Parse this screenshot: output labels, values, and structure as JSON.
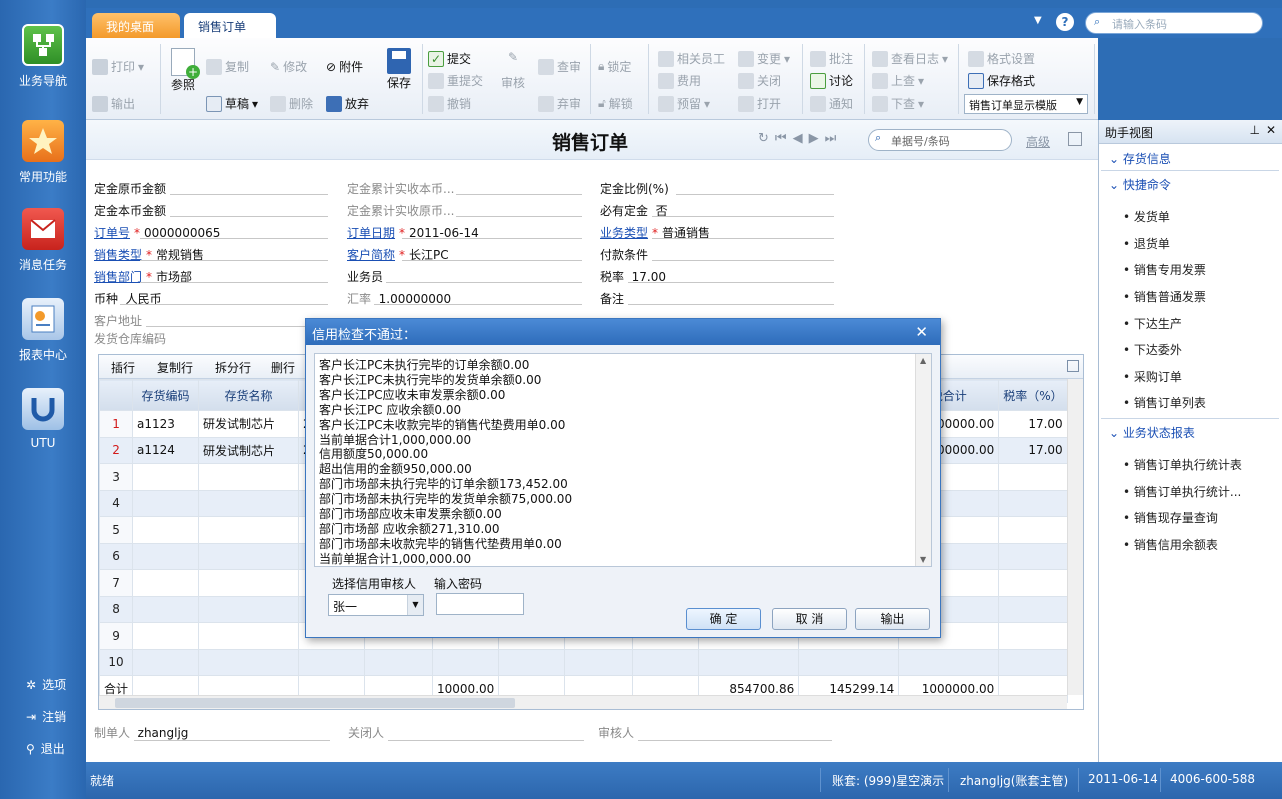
{
  "nav": {
    "items": [
      {
        "label": "业务导航",
        "icon": "flowchart-icon"
      },
      {
        "label": "常用功能",
        "icon": "star-icon"
      },
      {
        "label": "消息任务",
        "icon": "envelope-icon"
      },
      {
        "label": "报表中心",
        "icon": "report-icon"
      },
      {
        "label": "UTU",
        "icon": "utu-icon"
      }
    ],
    "bottom": [
      {
        "label": "选项",
        "icon": "gear-icon"
      },
      {
        "label": "注销",
        "icon": "logout-icon"
      },
      {
        "label": "退出",
        "icon": "key-icon"
      }
    ]
  },
  "tabs": [
    {
      "label": "我的桌面"
    },
    {
      "label": "销售订单"
    }
  ],
  "search": {
    "placeholder": "请输入条码"
  },
  "toolbar": {
    "print": "打印",
    "export": "输出",
    "ref": "参照",
    "copy": "复制",
    "draft": "草稿",
    "modify": "修改",
    "delete": "删除",
    "attach": "附件",
    "abandon": "放弃",
    "save": "保存",
    "submit": "提交",
    "resubmit": "重提交",
    "revoke": "撤销",
    "audit": "审核",
    "check_audit": "查审",
    "abandon_audit": "弃审",
    "lock": "锁定",
    "unlock": "解锁",
    "staff": "相关员工",
    "fee": "费用",
    "reserve": "预留",
    "change": "变更",
    "close": "关闭",
    "open": "打开",
    "annotate": "批注",
    "discuss": "讨论",
    "notify": "通知",
    "view_log": "查看日志",
    "prev": "上查",
    "next": "下查",
    "format_settings": "格式设置",
    "save_format": "保存格式",
    "template": "销售订单显示模版"
  },
  "form": {
    "title": "销售订单",
    "doc_search_placeholder": "单据号/条码",
    "advanced": "高级",
    "fields": {
      "deposit_orig_label": "定金原币金额",
      "deposit_local_label": "定金本币金额",
      "deposit_recv_local_label": "定金累计实收本币...",
      "deposit_recv_orig_label": "定金累计实收原币...",
      "deposit_ratio_label": "定金比例(%)",
      "must_deposit_label": "必有定金",
      "must_deposit": "否",
      "order_no_label": "订单号",
      "order_no": "0000000065",
      "order_date_label": "订单日期",
      "order_date": "2011-06-14",
      "biz_type_label": "业务类型",
      "biz_type": "普通销售",
      "sales_type_label": "销售类型",
      "sales_type": "常规销售",
      "customer_label": "客户简称",
      "customer": "长江PC",
      "payment_label": "付款条件",
      "dept_label": "销售部门",
      "dept": "市场部",
      "salesman_label": "业务员",
      "tax_rate_label": "税率",
      "tax_rate": "17.00",
      "currency_label": "币种",
      "currency": "人民币",
      "rate_label": "汇率",
      "rate": "1.00000000",
      "remark_label": "备注",
      "cust_addr_label": "客户地址",
      "ship_wh_label": "发货仓库编码"
    },
    "grid_toolbar": [
      "插行",
      "复制行",
      "拆分行",
      "删行"
    ],
    "columns": [
      "",
      "存货编码",
      "存货名称",
      "",
      "",
      "",
      "",
      "",
      "",
      "",
      "",
      "税合计",
      "税率（%）"
    ],
    "rows": [
      {
        "no": "1",
        "code": "a1123",
        "name": "研发试制芯片",
        "c3": "2",
        "total": "500000.00",
        "rate": "17.00"
      },
      {
        "no": "2",
        "code": "a1124",
        "name": "研发试制芯片",
        "c3": "2",
        "total": "500000.00",
        "rate": "17.00"
      },
      {
        "no": "3"
      },
      {
        "no": "4"
      },
      {
        "no": "5"
      },
      {
        "no": "6"
      },
      {
        "no": "7"
      },
      {
        "no": "8"
      },
      {
        "no": "9"
      },
      {
        "no": "10"
      }
    ],
    "sum": {
      "label": "合计",
      "qty": "10000.00",
      "amount": "854700.86",
      "tax": "145299.14",
      "total": "1000000.00"
    },
    "footer": {
      "maker_label": "制单人",
      "maker": "zhangljg",
      "closer_label": "关闭人",
      "auditor_label": "审核人"
    }
  },
  "assistant": {
    "title": "助手视图",
    "sections": [
      {
        "label": "存货信息"
      },
      {
        "label": "快捷命令",
        "items": [
          "发货单",
          "退货单",
          "销售专用发票",
          "销售普通发票",
          "下达生产",
          "下达委外",
          "采购订单",
          "销售订单列表"
        ]
      },
      {
        "label": "业务状态报表",
        "items": [
          "销售订单执行统计表",
          "销售订单执行统计...",
          "销售现存量查询",
          "销售信用余额表"
        ]
      }
    ]
  },
  "dialog": {
    "title": "信用检查不通过：",
    "lines": [
      "客户长江PC未执行完毕的订单余额0.00",
      "客户长江PC未执行完毕的发货单余额0.00",
      "客户长江PC应收未审发票余额0.00",
      "客户长江PC 应收余额0.00",
      "客户长江PC未收款完毕的销售代垫费用单0.00",
      "当前单据合计1,000,000.00",
      "信用额度50,000.00",
      "超出信用的金额950,000.00",
      "部门市场部未执行完毕的订单余额173,452.00",
      "部门市场部未执行完毕的发货单余额75,000.00",
      "部门市场部应收未审发票余额0.00",
      "部门市场部 应收余额271,310.00",
      "部门市场部未收款完毕的销售代垫费用单0.00",
      "当前单据合计1,000,000.00"
    ],
    "approver_label": "选择信用审核人",
    "approver": "张一",
    "password_label": "输入密码",
    "ok": "确 定",
    "cancel": "取 消",
    "export": "输出"
  },
  "status": {
    "state": "就绪",
    "account": "账套: (999)星空演示",
    "user": "zhangljg(账套主管)",
    "date": "2011-06-14",
    "phone": "4006-600-588"
  },
  "colors": {
    "brand_blue": "#2d6db5",
    "tab_active_orange": "#f39a2b",
    "link_blue": "#1a4fb4",
    "required_red": "#e02020"
  }
}
